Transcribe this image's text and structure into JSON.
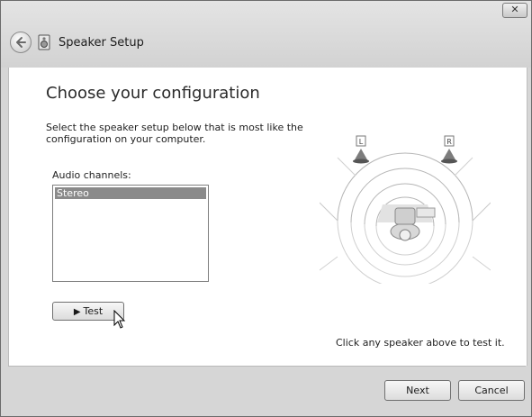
{
  "window": {
    "title": "Speaker Setup",
    "close_glyph": "✕"
  },
  "main": {
    "heading": "Choose your configuration",
    "description": "Select the speaker setup below that is most like the configuration on your computer.",
    "channels_label": "Audio channels:",
    "channels": [
      "Stereo"
    ],
    "selected_channel": "Stereo",
    "test_label": "Test",
    "hint": "Click any speaker above to test it."
  },
  "diagram": {
    "left_speaker_label": "L",
    "right_speaker_label": "R"
  },
  "footer": {
    "next_label": "Next",
    "cancel_label": "Cancel"
  },
  "icons": {
    "back": "back-arrow-icon",
    "app": "speaker-setup-icon",
    "close": "close-icon",
    "play": "play-icon",
    "cursor": "mouse-cursor-icon"
  }
}
